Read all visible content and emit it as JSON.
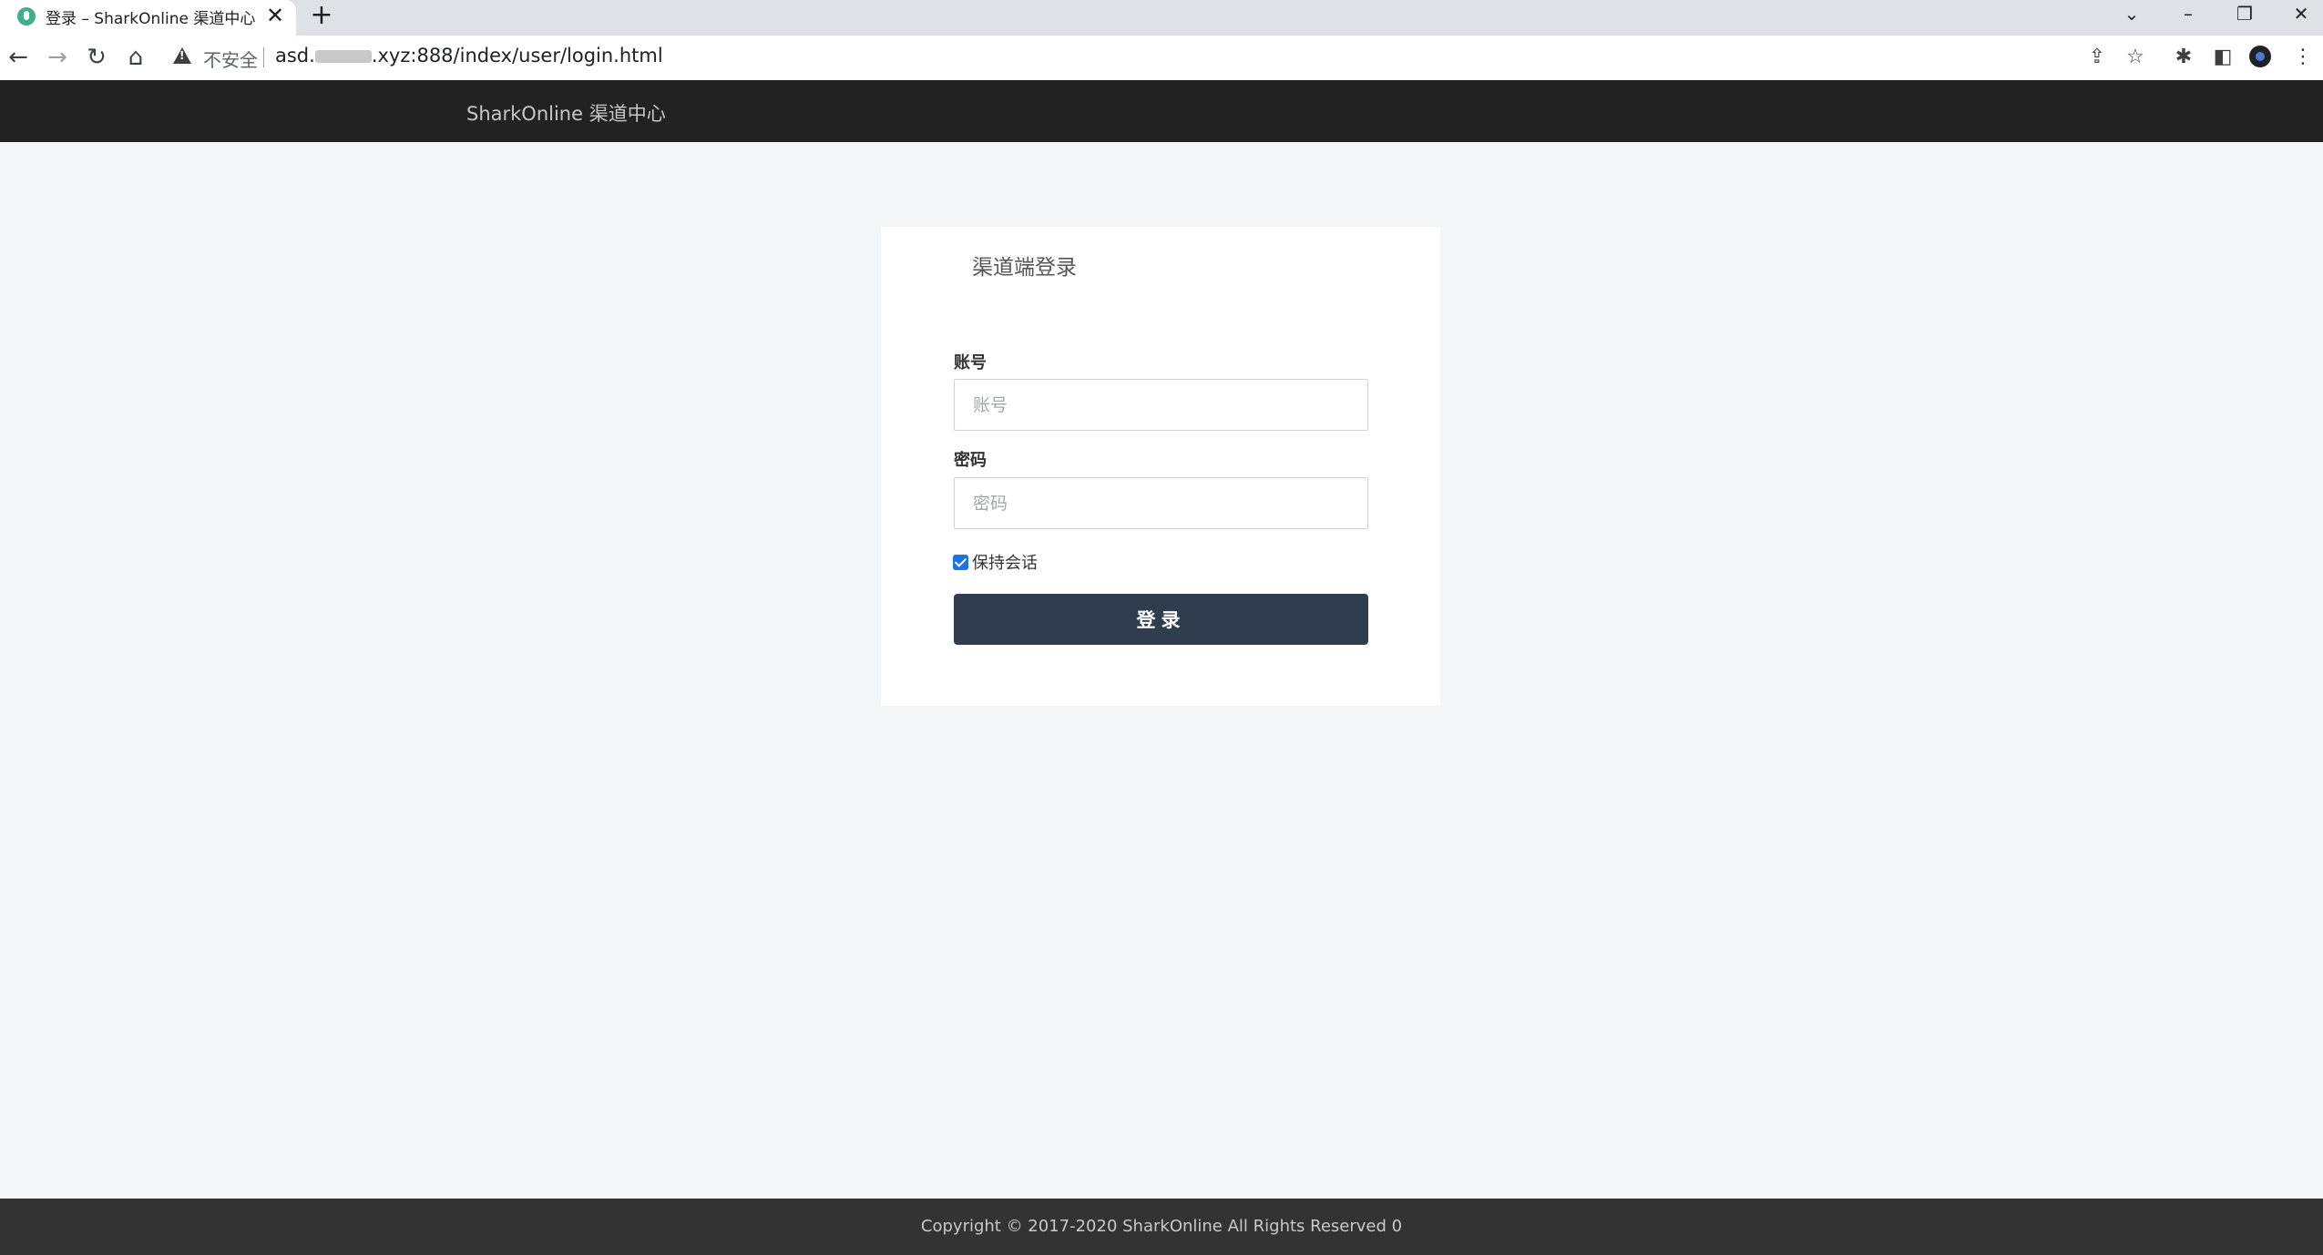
{
  "browser": {
    "tab": {
      "title": "登录 – SharkOnline 渠道中心",
      "close_glyph": "✕"
    },
    "new_tab_glyph": "+",
    "window_controls": {
      "tab_search": "⌄",
      "minimize": "–",
      "restore": "❐",
      "close": "✕"
    },
    "nav": {
      "back": "←",
      "forward": "→",
      "reload": "↻",
      "home": "⌂"
    },
    "omnibox": {
      "security_label": "不安全",
      "url_prefix": "asd.",
      "url_suffix": ".xyz:888/index/user/login.html"
    },
    "toolbar_right": {
      "share": "⇪",
      "bookmark": "☆",
      "extensions": "✱",
      "side_panel": "◧",
      "menu": "⋮"
    }
  },
  "header": {
    "brand": "SharkOnline 渠道中心"
  },
  "login": {
    "title": "渠道端登录",
    "account_label": "账号",
    "account_placeholder": "账号",
    "account_value": "",
    "password_label": "密码",
    "password_placeholder": "密码",
    "password_value": "",
    "remember_label": "保持会话",
    "remember_checked": true,
    "submit_label": "登录"
  },
  "footer": {
    "copyright": "Copyright © 2017-2020 SharkOnline All Rights Reserved 0"
  },
  "colors": {
    "header_bg": "#222222",
    "page_bg": "#f4f5f7",
    "button_bg": "#2f3d4f",
    "footer_bg": "#333333",
    "checkbox": "#1a73e8"
  }
}
